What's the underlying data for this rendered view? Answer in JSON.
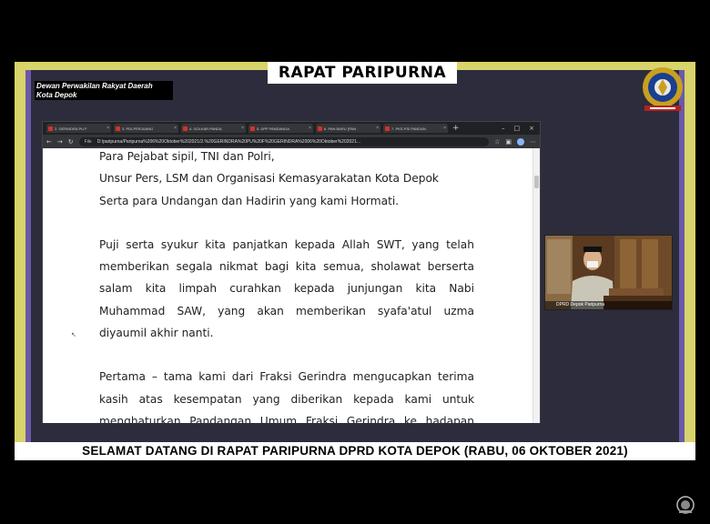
{
  "header": {
    "title": "RAPAT PARIPURNA",
    "org_line1": "Dewan Perwakilan Rakyat Daerah",
    "org_line2": "Kota Depok"
  },
  "browser": {
    "tabs": [
      {
        "label": "2. GERINDRA PU F"
      },
      {
        "label": "3. PDI-PERJUANG"
      },
      {
        "label": "4. GOLKAR PANDA"
      },
      {
        "label": "5. DPP PANDANGA"
      },
      {
        "label": "6. PAN BARU (PAN"
      },
      {
        "label": "7. PKS-PSI PANDAN"
      }
    ],
    "file_tag": "File",
    "url": "D:/paripurna/Paripurna%206%20Oktober%202021/2.%20GERINDRA%20PU%20F%20GERINDRA%2006%20Oktober%202021..."
  },
  "document": {
    "lines_top": [
      "Para Pejabat sipil, TNI dan Polri,",
      "Unsur Pers, LSM dan Organisasi Kemasyarakatan Kota Depok",
      "Serta para Undangan dan Hadirin yang kami Hormati."
    ],
    "paragraph_1": "Puji serta syukur kita panjatkan kepada Allah SWT, yang telah memberikan segala nikmat bagi kita semua, sholawat berserta salam kita limpah curahkan kepada junjungan kita Nabi Muhammad SAW, yang akan memberikan syafa'atul uzma diyaumil akhir nanti.",
    "paragraph_2": "Pertama – tama kami dari Fraksi Gerindra mengucapkan terima kasih atas kesempatan yang diberikan kepada kami untuk menghaturkan Pandangan Umum Fraksi Gerindra ke hadapan Rapat Paripurna yang sangat Kami Hormati ini."
  },
  "camera": {
    "caption": "DPRD Depok Paripurna"
  },
  "ticker": {
    "text": "SELAMAT DATANG DI RAPAT PARIPURNA DPRD KOTA DEPOK  (RABU, 06 OKTOBER 2021)"
  },
  "colors": {
    "frame_outer": "#d8d36a",
    "frame_inner": "#2c2c3c",
    "frame_side": "#6a5aa8",
    "browser_chrome": "#202124"
  }
}
